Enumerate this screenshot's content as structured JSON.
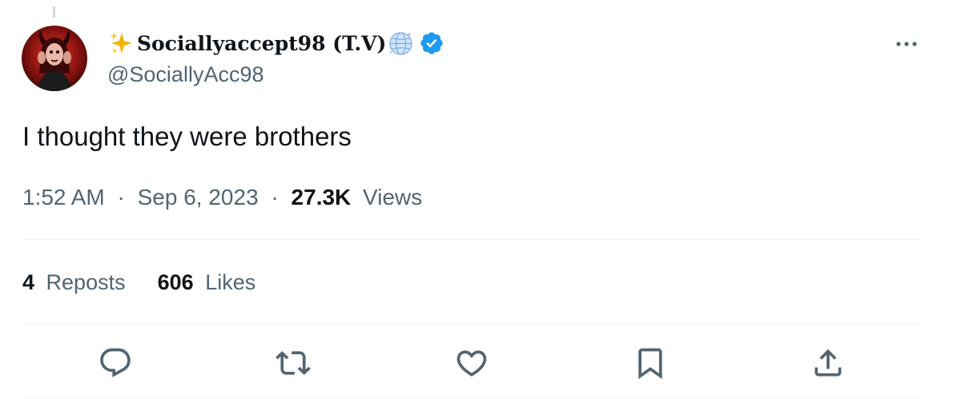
{
  "author": {
    "display_name": "Sociallyaccept98 (T.V)",
    "handle": "@SociallyAcc98",
    "verified": true
  },
  "tweet": {
    "text": "I thought they were brothers",
    "time": "1:52 AM",
    "separator": "·",
    "date": "Sep 6, 2023",
    "views_count": "27.3K",
    "views_label": "Views"
  },
  "stats": {
    "reposts_count": "4",
    "reposts_label": "Reposts",
    "likes_count": "606",
    "likes_label": "Likes"
  },
  "icons": {
    "more": "more-horizontal-icon",
    "reply": "reply-icon",
    "repost": "repost-icon",
    "like": "heart-icon",
    "bookmark": "bookmark-icon",
    "share": "share-icon"
  },
  "colors": {
    "text": "#0f1419",
    "secondary": "#536471",
    "verified": "#1d9bf0",
    "divider": "#eff3f4",
    "sparkle": "#f4b400"
  }
}
